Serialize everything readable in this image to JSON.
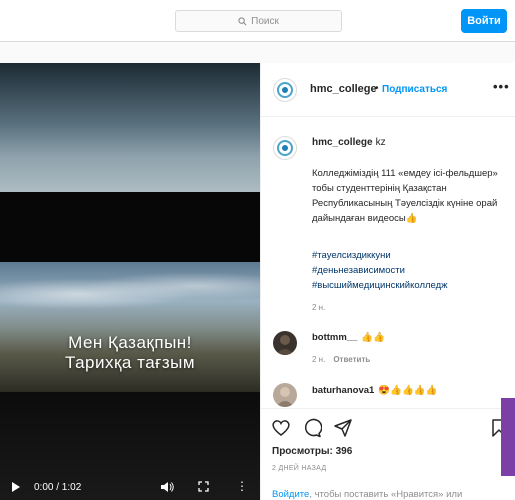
{
  "header": {
    "search_placeholder": "Поиск",
    "login_label": "Войти"
  },
  "video": {
    "overlay_line1": "Мен Қазақпын!",
    "overlay_line2": "Тарихқа тағзым",
    "time": "0:00 / 1:02"
  },
  "post": {
    "username": "hmc_college",
    "follow_label": "Подписаться",
    "separator": "•",
    "more_label": "•••"
  },
  "caption": {
    "username": "hmc_college",
    "suffix": "kz",
    "text": "Колледжіміздің 111 «емдеу ісі-фельдшер» тобы студенттерінің Қазақстан Республикасының Тәуелсіздік күніне орай дайындаған видеосы👍",
    "hashtags": [
      "#тауелсиздиккуни",
      "#деньнезависимости",
      "#высшиймедицинскийколледж"
    ],
    "time": "2 н."
  },
  "comments": [
    {
      "username": "bottmm__",
      "text": "👍👍",
      "time": "2 н.",
      "reply_label": "Ответить"
    },
    {
      "username": "baturhanova1",
      "text": "😍👍👍👍👍"
    }
  ],
  "stats": {
    "views": "Просмотры: 396",
    "ago": "2 ДНЕЙ НАЗАД",
    "login_link": "Войдите",
    "login_rest": ", чтобы поставить «Нравится» или"
  },
  "colors": {
    "accent": "#0095f6",
    "hashtag": "#00376b",
    "muted": "#8e8e8e"
  }
}
